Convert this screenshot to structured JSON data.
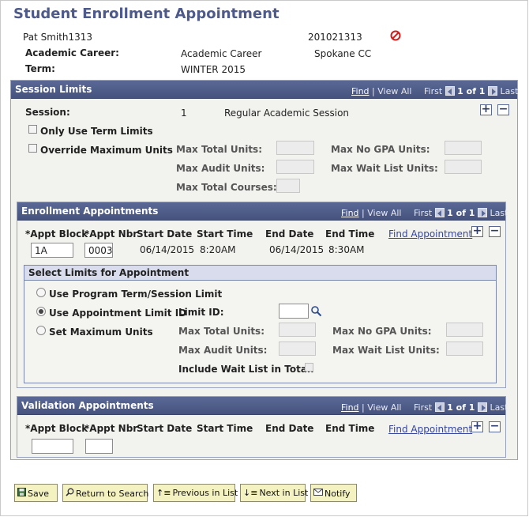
{
  "page": {
    "title": "Student Enrollment Appointment",
    "student_name": "Pat Smith1313",
    "student_id": "201021313",
    "academic_career_label": "Academic Career:",
    "academic_career_value": "Academic Career",
    "institution": "Spokane CC",
    "term_label": "Term:",
    "term_value": "WINTER 2015"
  },
  "nav": {
    "find": "Find",
    "view_all": "View All",
    "first": "First",
    "count": "1 of 1",
    "last": "Last"
  },
  "session_limits": {
    "header": "Session Limits",
    "session_label": "Session:",
    "session_number": "1",
    "session_name": "Regular Academic Session",
    "only_use_term_limits": "Only Use Term Limits",
    "override_maximum_units": "Override Maximum Units",
    "max_total_units": "Max Total Units:",
    "max_no_gpa_units": "Max No GPA Units:",
    "max_audit_units": "Max Audit Units:",
    "max_wait_list_units": "Max Wait List Units:",
    "max_total_courses": "Max Total Courses:"
  },
  "enrollment_appointments": {
    "header": "Enrollment Appointments",
    "col_appt_block": "*Appt Block",
    "col_appt_nbr": "*Appt Nbr",
    "col_start_date": "Start Date",
    "col_start_time": "Start Time",
    "col_end_date": "End Date",
    "col_end_time": "End Time",
    "find_appointment": "Find Appointment",
    "row": {
      "appt_block": "1A",
      "appt_nbr": "0003",
      "start_date": "06/14/2015",
      "start_time": "8:20AM",
      "end_date": "06/14/2015",
      "end_time": "8:30AM"
    }
  },
  "select_limits": {
    "header": "Select Limits for Appointment",
    "opt_program": "Use Program Term/Session Limit",
    "opt_limit_id": "Use Appointment Limit ID",
    "opt_set_max": "Set Maximum Units",
    "selected": "Use Appointment Limit ID",
    "limit_id_label": "Limit ID:",
    "limit_id_value": "",
    "max_total_units": "Max Total Units:",
    "max_no_gpa_units": "Max No GPA Units:",
    "max_audit_units": "Max Audit Units:",
    "max_wait_list_units": "Max Wait List Units:",
    "include_wait_list": "Include Wait List in Total:"
  },
  "validation_appointments": {
    "header": "Validation Appointments",
    "col_appt_block": "*Appt Block",
    "col_appt_nbr": "*Appt Nbr",
    "col_start_date": "Start Date",
    "col_start_time": "Start Time",
    "col_end_date": "End Date",
    "col_end_time": "End Time",
    "find_appointment": "Find Appointment",
    "row": {
      "appt_block": "",
      "appt_nbr": ""
    }
  },
  "toolbar": {
    "save": "Save",
    "return_to_search": "Return to Search",
    "previous_in_list": "Previous in List",
    "next_in_list": "Next in List",
    "notify": "Notify"
  },
  "colors": {
    "header_bar": "#4f5c88",
    "title": "#4d5a8a",
    "button_bg": "#f4f2c0",
    "link": "#3545a0"
  }
}
